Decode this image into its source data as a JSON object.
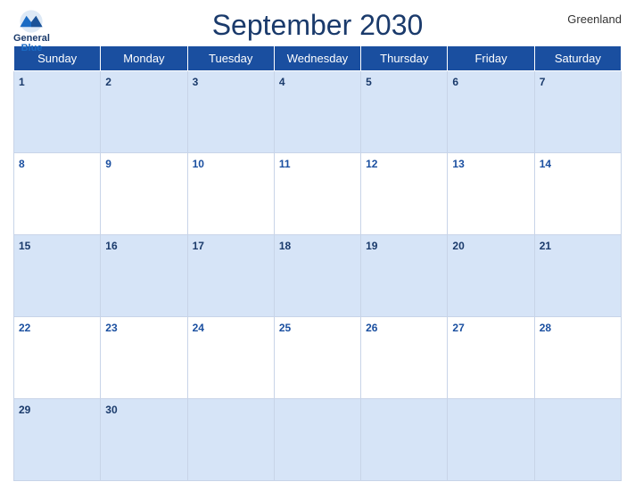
{
  "header": {
    "title": "September 2030",
    "region": "Greenland",
    "logo": {
      "general": "General",
      "blue": "Blue"
    }
  },
  "days": [
    "Sunday",
    "Monday",
    "Tuesday",
    "Wednesday",
    "Thursday",
    "Friday",
    "Saturday"
  ],
  "weeks": [
    [
      1,
      2,
      3,
      4,
      5,
      6,
      7
    ],
    [
      8,
      9,
      10,
      11,
      12,
      13,
      14
    ],
    [
      15,
      16,
      17,
      18,
      19,
      20,
      21
    ],
    [
      22,
      23,
      24,
      25,
      26,
      27,
      28
    ],
    [
      29,
      30,
      null,
      null,
      null,
      null,
      null
    ]
  ]
}
